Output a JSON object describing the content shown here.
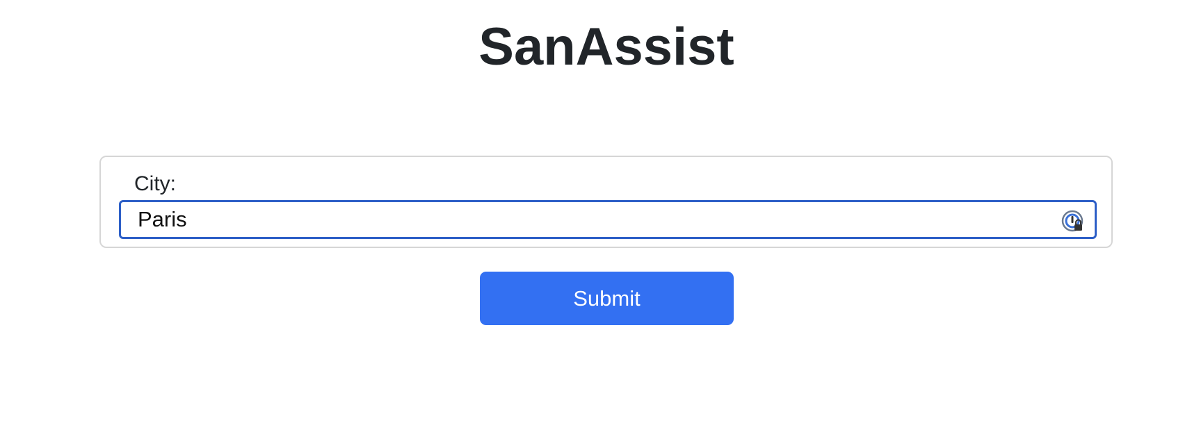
{
  "app": {
    "title": "SanAssist"
  },
  "form": {
    "city_label": "City:",
    "city_value": "Paris",
    "submit_label": "Submit"
  },
  "icons": {
    "password_manager": "password-manager-icon"
  },
  "colors": {
    "accent": "#3370f2",
    "input_focus_border": "#2d5fc7",
    "card_border": "#d6d6d6",
    "title_text": "#212529"
  }
}
